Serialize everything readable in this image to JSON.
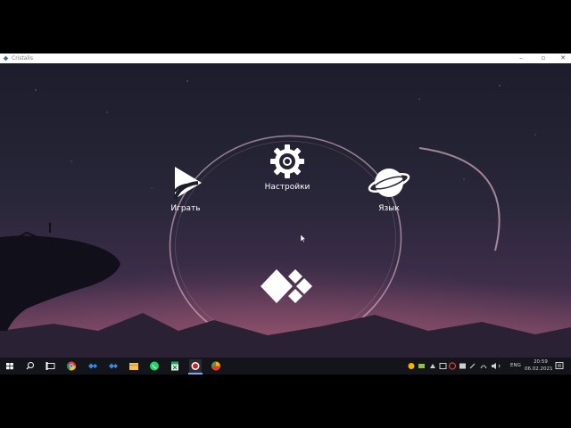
{
  "window": {
    "title": "Cristalis"
  },
  "menu": {
    "play_label": "Играть",
    "settings_label": "Настройки",
    "language_label": "Язык"
  },
  "taskbar": {
    "language": "ENG",
    "time": "20:59",
    "date": "06.02.2021",
    "pinned_icons": [
      "windows-start-icon",
      "search-icon",
      "task-view-icon",
      "chrome-icon",
      "app-icon",
      "app-icon",
      "file-explorer-icon",
      "whatsapp-icon",
      "spreadsheet-icon",
      "record-icon",
      "color-app-icon"
    ]
  },
  "colors": {
    "sky_top": "#1c1d2c",
    "sky_mid": "#332a45",
    "horizon": "#8d4f6b",
    "taskbar": "#14151a",
    "ring": "#f3c9dc"
  }
}
